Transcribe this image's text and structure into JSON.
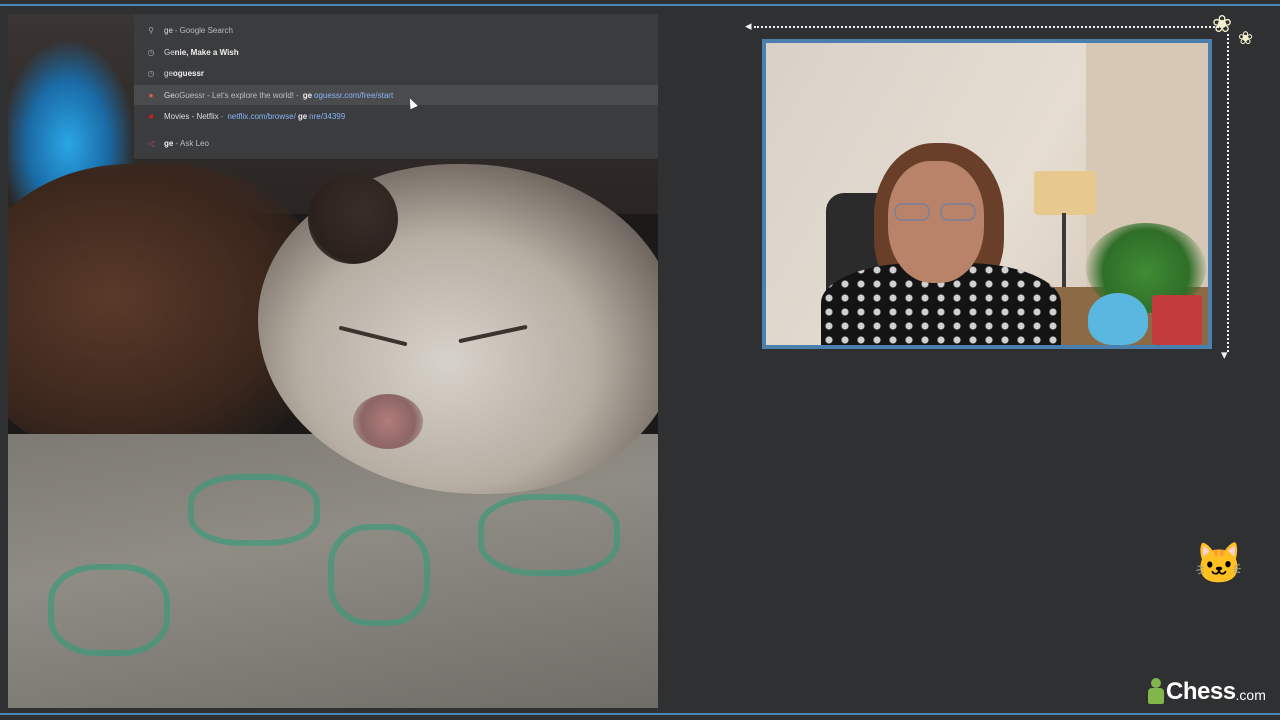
{
  "omnibox": {
    "rows": [
      {
        "icon": "search-icon",
        "parts": [
          {
            "t": "ge",
            "b": false
          },
          {
            "t": " - ",
            "b": false,
            "sep": true
          },
          {
            "t": "Google Search",
            "b": false,
            "muted": true
          }
        ]
      },
      {
        "icon": "history-icon",
        "parts": [
          {
            "t": "Ge",
            "b": false
          },
          {
            "t": "nie, Make a Wish",
            "b": true
          }
        ]
      },
      {
        "icon": "history-icon",
        "parts": [
          {
            "t": "ge",
            "b": false
          },
          {
            "t": "oguessr",
            "b": true
          }
        ]
      },
      {
        "icon": "geoguessr-favicon-icon",
        "hover": true,
        "parts": [
          {
            "t": "Ge",
            "b": false
          },
          {
            "t": "oGuessr - Let's explore the world!",
            "b": false,
            "muted": true
          },
          {
            "t": " - ",
            "sep": true
          },
          {
            "t": "ge",
            "b": true,
            "url": true
          },
          {
            "t": "oguessr.com/free/start",
            "url": true
          }
        ]
      },
      {
        "icon": "netflix-favicon-icon",
        "parts": [
          {
            "t": "Movies - Netflix",
            "b": false
          },
          {
            "t": " - ",
            "sep": true
          },
          {
            "t": "netflix.com/browse/",
            "url": true
          },
          {
            "t": "ge",
            "b": true,
            "url": true
          },
          {
            "t": "nre/34399",
            "url": true
          }
        ]
      },
      {
        "icon": "leo-icon",
        "parts": [
          {
            "t": "ge",
            "b": true
          },
          {
            "t": " - ",
            "sep": true
          },
          {
            "t": "Ask Leo",
            "muted": true
          }
        ]
      }
    ]
  },
  "branding": {
    "logo_word": "Chess",
    "logo_domain": ".com",
    "accent_color": "#81b64c"
  },
  "decor": {
    "flower_glyph": "❀",
    "cat_glyph": "🐱",
    "arrow_left": "◂",
    "arrow_down": "▾"
  },
  "colors": {
    "frame": "#4a86b8",
    "background": "#2e3031",
    "omnibox_bg": "#3b3c3e",
    "link": "#8ab4f8"
  }
}
